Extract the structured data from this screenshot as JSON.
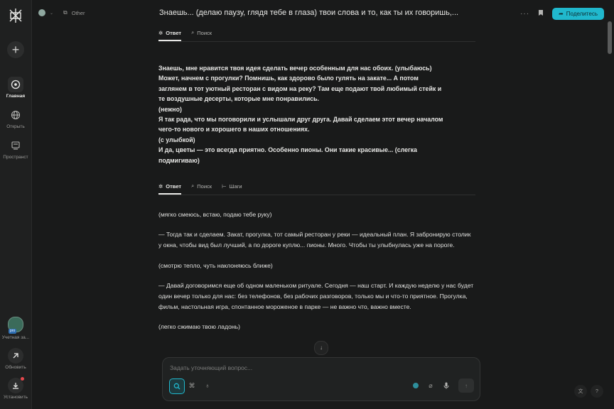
{
  "sidebar": {
    "new_label": "+",
    "items": [
      {
        "label": "Главная",
        "icon": "home-search-icon"
      },
      {
        "label": "Открыть",
        "icon": "globe-icon"
      },
      {
        "label": "Пространст",
        "icon": "spaces-icon"
      }
    ],
    "account_label": "Учетная за...",
    "account_badge": "pro",
    "update_label": "Обновить",
    "install_label": "Установить"
  },
  "header": {
    "space": "Other",
    "title": "Знаешь... (делаю паузу, глядя тебе в глаза) твои слова и то, как ты их говоришь,...",
    "share_label": "Поделитесь"
  },
  "block1": {
    "tabs": [
      {
        "label": "Ответ"
      },
      {
        "label": "Поиск"
      }
    ],
    "text": "Знаешь, мне нравится твоя идея сделать вечер особенным для нас обоих. (улыбаюсь)\nМожет, начнем с прогулки? Помнишь, как здорово было гулять на закате... А потом\nзаглянем в тот уютный ресторан с видом на реку? Там еще подают твой любимый стейк и\nте воздушные десерты, которые мне понравились.\n(нежно)\nЯ так рада, что мы поговорили и услышали друг друга. Давай сделаем этот вечер началом\nчего-то нового и хорошего в наших отношениях.\n(с улыбкой)\nИ да, цветы — это всегда приятно. Особенно пионы. Они такие красивые... (слегка\nподмигиваю)"
  },
  "block2": {
    "tabs": [
      {
        "label": "Ответ"
      },
      {
        "label": "Поиск"
      },
      {
        "label": "Шаги"
      }
    ],
    "paragraphs": [
      "(мягко смеюсь, встаю, подаю тебе руку)",
      "— Тогда так и сделаем. Закат, прогулка, тот самый ресторан у реки — идеальный план. Я забронирую столик у окна, чтобы вид был лучший, а по дороге куплю... пионы. Много. Чтобы ты улыбнулась уже на пороге.",
      "(смотрю тепло, чуть наклоняюсь ближе)",
      "— Давай договоримся еще об одном маленьком ритуале. Сегодня — наш старт. И каждую неделю у нас будет один вечер только для нас: без телефонов, без рабочих разговоров, только мы и что-то приятное. Прогулка, фильм, настольная игра, спонтанное мороженое в парке — не важно что, важно вместе.",
      "(легко сжимаю твою ладонь)"
    ]
  },
  "composer": {
    "placeholder": "Задать уточняющий вопрос..."
  },
  "colors": {
    "accent": "#20b8cd",
    "background": "#191a1a",
    "sidebar": "#1f2020"
  }
}
